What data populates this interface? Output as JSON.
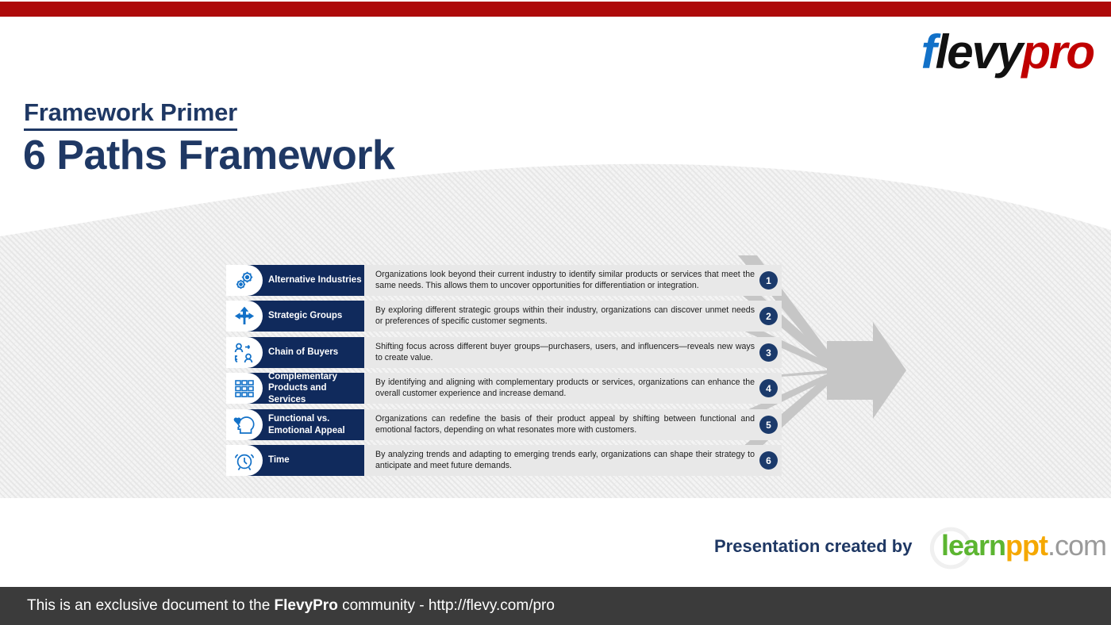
{
  "brand": {
    "logo_f": "f",
    "logo_levy": "levy",
    "logo_pro": "pro",
    "red_bar_color": "#ae0a0a",
    "navy": "#1f3864",
    "bar_navy": "#102a5c",
    "icon_blue": "#1271c8"
  },
  "header": {
    "eyebrow": "Framework Primer",
    "title": "6 Paths Framework"
  },
  "rows": [
    {
      "number": "1",
      "label": "Alternative Industries",
      "icon": "gears-icon",
      "description": "Organizations look beyond their current industry to identify similar products or services that meet the same needs. This allows them to uncover opportunities for differentiation or integration."
    },
    {
      "number": "2",
      "label": "Strategic Groups",
      "icon": "split-arrows-icon",
      "description": "By exploring different strategic groups within their industry, organizations can discover unmet needs or preferences of specific customer segments."
    },
    {
      "number": "3",
      "label": "Chain of Buyers",
      "icon": "people-exchange-icon",
      "description": "Shifting focus across different buyer groups—purchasers, users, and influencers—reveals new ways to create value."
    },
    {
      "number": "4",
      "label": "Complementary Products and Services",
      "icon": "grid-squares-icon",
      "description": "By identifying and aligning with complementary products or services, organizations can enhance the overall customer experience and increase demand."
    },
    {
      "number": "5",
      "label": "Functional vs. Emotional Appeal",
      "icon": "head-heart-icon",
      "description": "Organizations can redefine the basis of their product appeal by shifting between functional and emotional factors, depending on what resonates more with customers."
    },
    {
      "number": "6",
      "label": "Time",
      "icon": "alarm-clock-icon",
      "description": "By analyzing trends and adapting to emerging trends early, organizations can shape their strategy to anticipate and meet future demands."
    }
  ],
  "footer": {
    "created_by": "Presentation created by",
    "learnppt_learn": "learn",
    "learnppt_ppt": "ppt",
    "learnppt_com": ".com",
    "notice_lead": "This is an exclusive document to the ",
    "notice_brand": "FlevyPro",
    "notice_tail": " community - http://flevy.com/pro"
  }
}
